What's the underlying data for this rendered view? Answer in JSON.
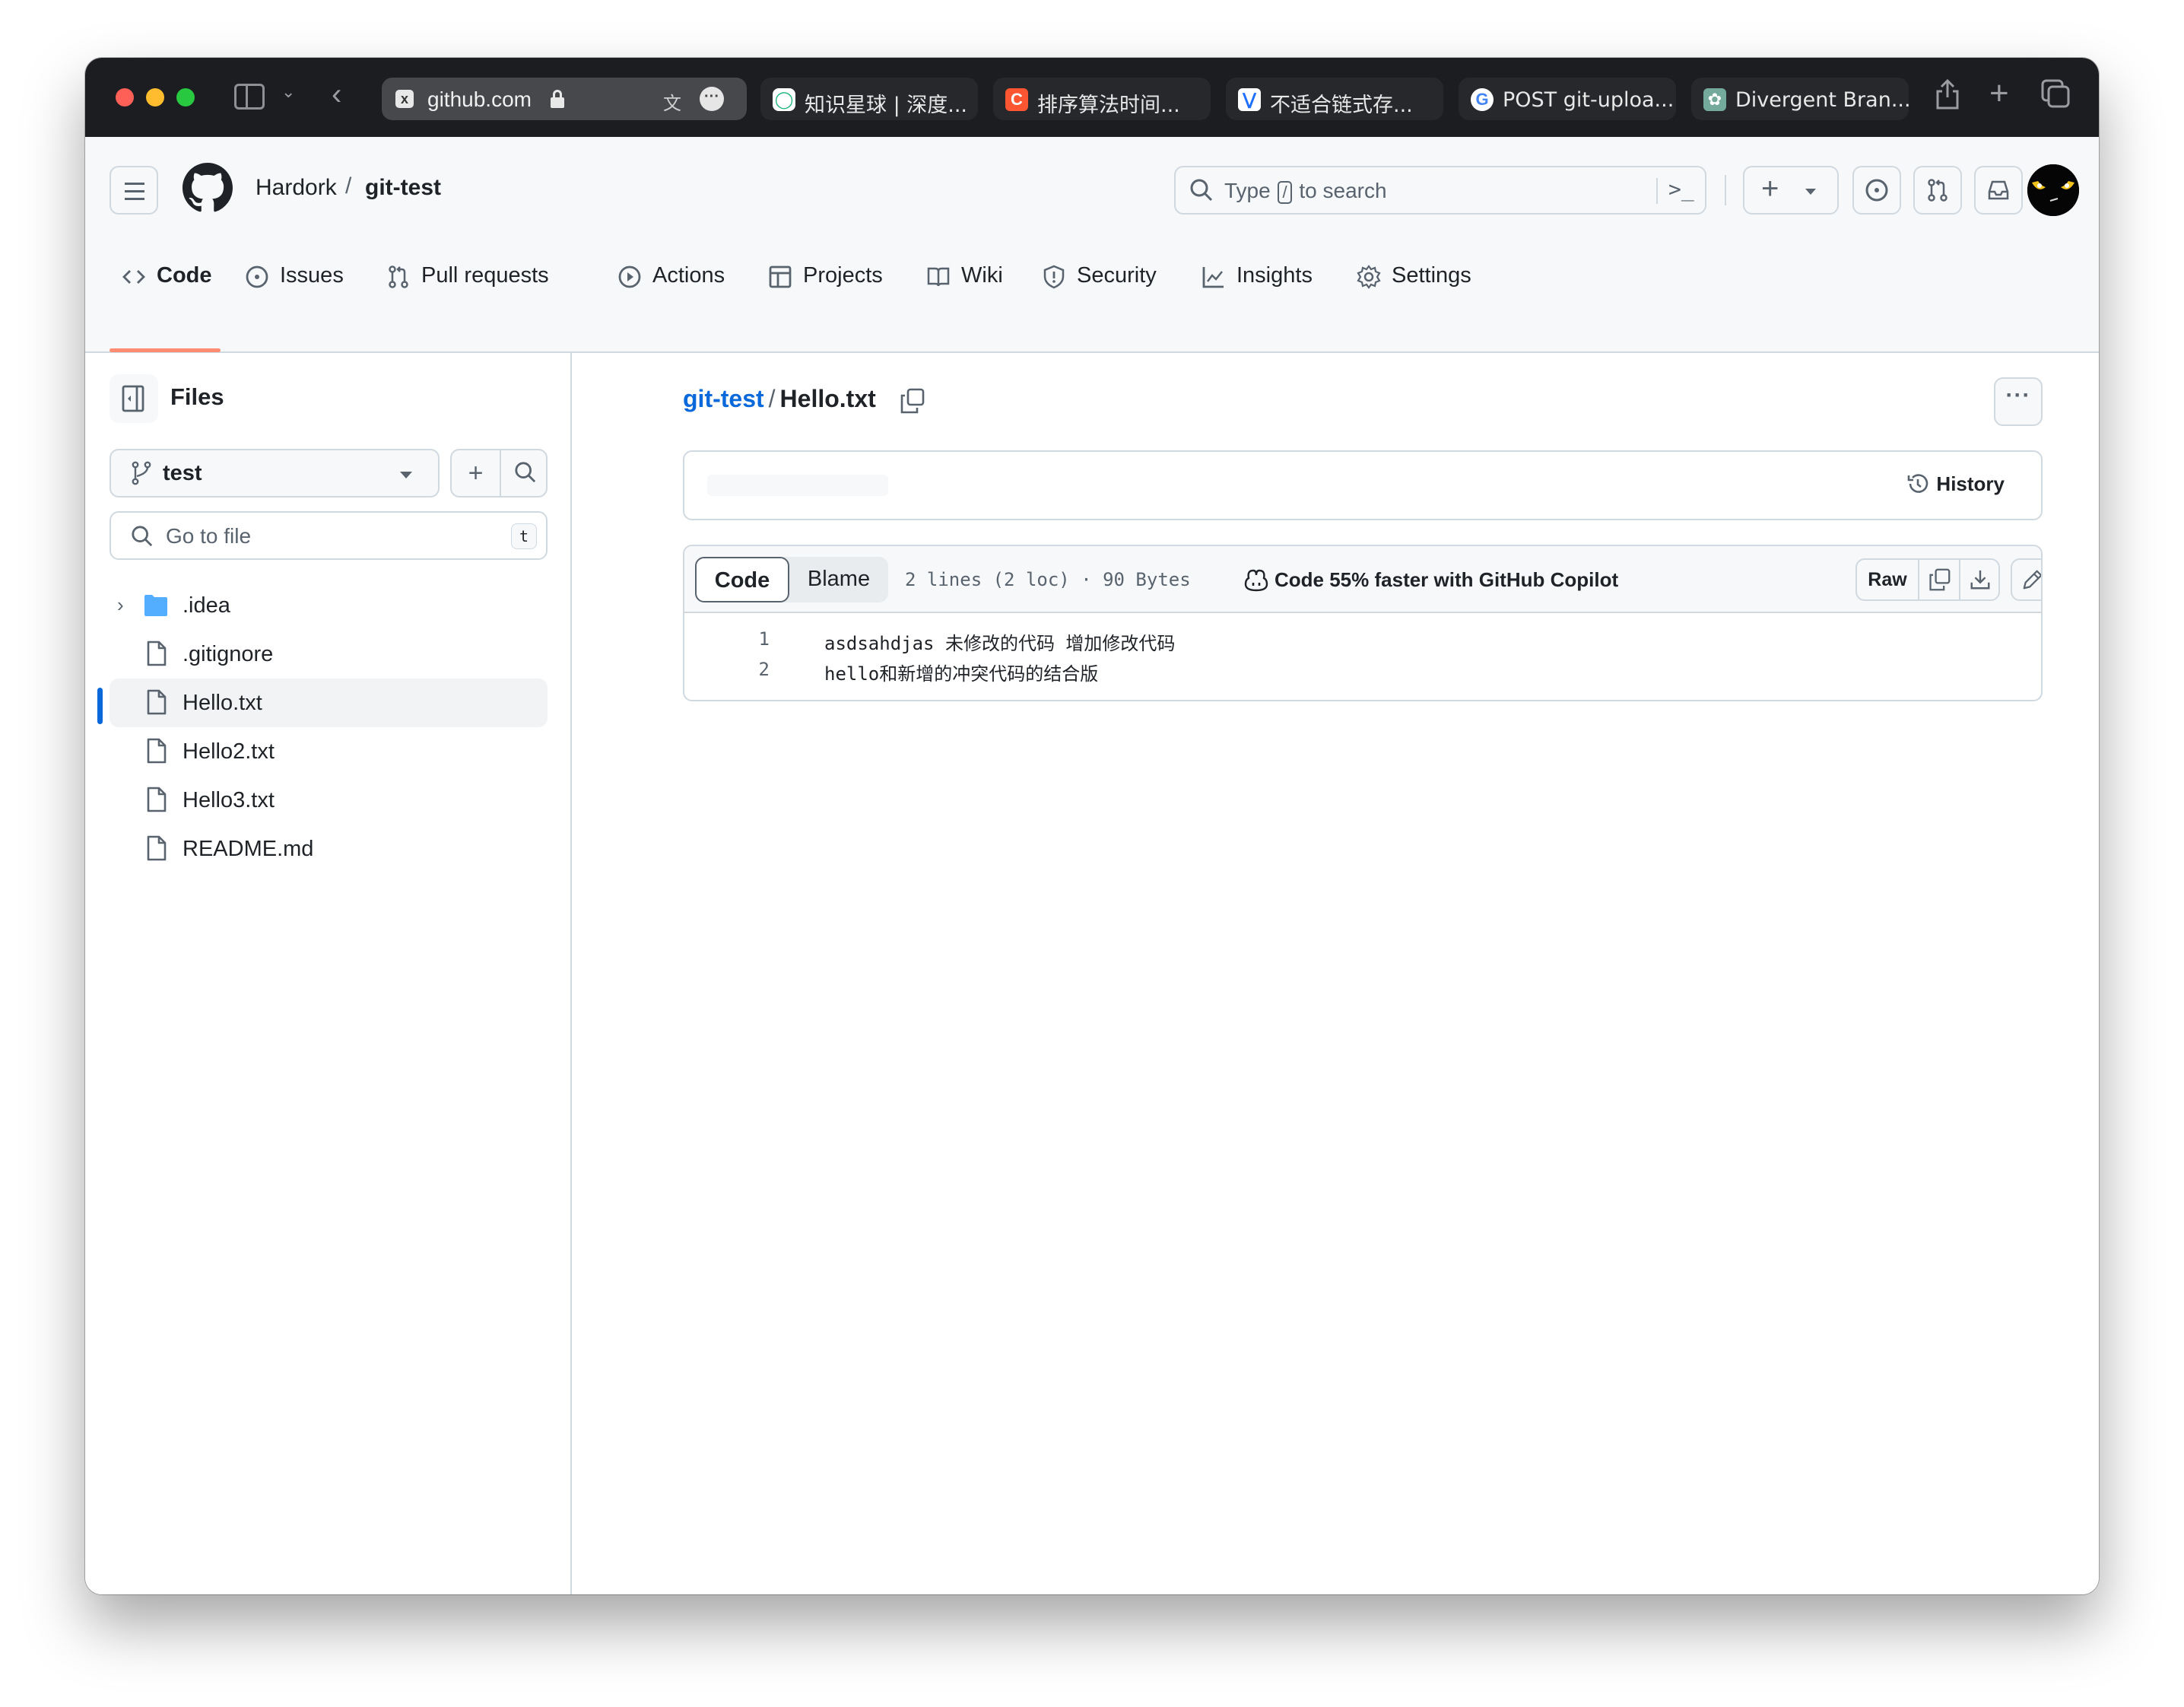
{
  "browser": {
    "url": "github.com",
    "tabs": [
      {
        "title": "知识星球 | 深度...",
        "favicon": "zsxq-icon",
        "color": "#1fb57d"
      },
      {
        "title": "排序算法时间...",
        "favicon": "csdn-icon",
        "color": "#fc5531"
      },
      {
        "title": "不适合链式存...",
        "favicon": "bookmark-blue-icon",
        "color": "#1e6fff"
      },
      {
        "title": "POST git-uploa...",
        "favicon": "google-icon",
        "color": "#4285f4"
      },
      {
        "title": "Divergent Bran...",
        "favicon": "chatgpt-icon",
        "color": "#74aa9c"
      }
    ]
  },
  "header": {
    "owner": "Hardork",
    "separator": "/",
    "repo": "git-test",
    "search_placeholder_pre": "Type",
    "search_key": "/",
    "search_placeholder_post": "to search",
    "command_palette": ">_"
  },
  "nav": {
    "items": [
      {
        "label": "Code",
        "icon": "code-icon",
        "active": true
      },
      {
        "label": "Issues",
        "icon": "issue-opened-icon"
      },
      {
        "label": "Pull requests",
        "icon": "git-pull-request-icon"
      },
      {
        "label": "Actions",
        "icon": "play-icon"
      },
      {
        "label": "Projects",
        "icon": "table-icon"
      },
      {
        "label": "Wiki",
        "icon": "book-icon"
      },
      {
        "label": "Security",
        "icon": "shield-icon"
      },
      {
        "label": "Insights",
        "icon": "graph-icon"
      },
      {
        "label": "Settings",
        "icon": "gear-icon"
      }
    ]
  },
  "sidebar": {
    "title": "Files",
    "branch": "test",
    "goto_placeholder": "Go to file",
    "goto_shortcut": "t",
    "tree": [
      {
        "name": ".idea",
        "type": "folder",
        "expandable": true
      },
      {
        "name": ".gitignore",
        "type": "file"
      },
      {
        "name": "Hello.txt",
        "type": "file",
        "selected": true
      },
      {
        "name": "Hello2.txt",
        "type": "file"
      },
      {
        "name": "Hello3.txt",
        "type": "file"
      },
      {
        "name": "README.md",
        "type": "file"
      }
    ]
  },
  "file": {
    "repo_link": "git-test",
    "separator": "/",
    "name": "Hello.txt",
    "history_label": "History",
    "view_tabs": {
      "code": "Code",
      "blame": "Blame"
    },
    "meta": "2 lines (2 loc) · 90 Bytes",
    "copilot_promo": "Code 55% faster with GitHub Copilot",
    "raw_label": "Raw",
    "lines": [
      {
        "number": "1",
        "text": "asdsahdjas 未修改的代码 增加修改代码"
      },
      {
        "number": "2",
        "text": "hello和新增的冲突代码的结合版"
      }
    ]
  },
  "colors": {
    "accent_link": "#0969da",
    "nav_underline": "#fd8c73",
    "folder": "#54aeff",
    "selected_bar": "#0969da"
  }
}
